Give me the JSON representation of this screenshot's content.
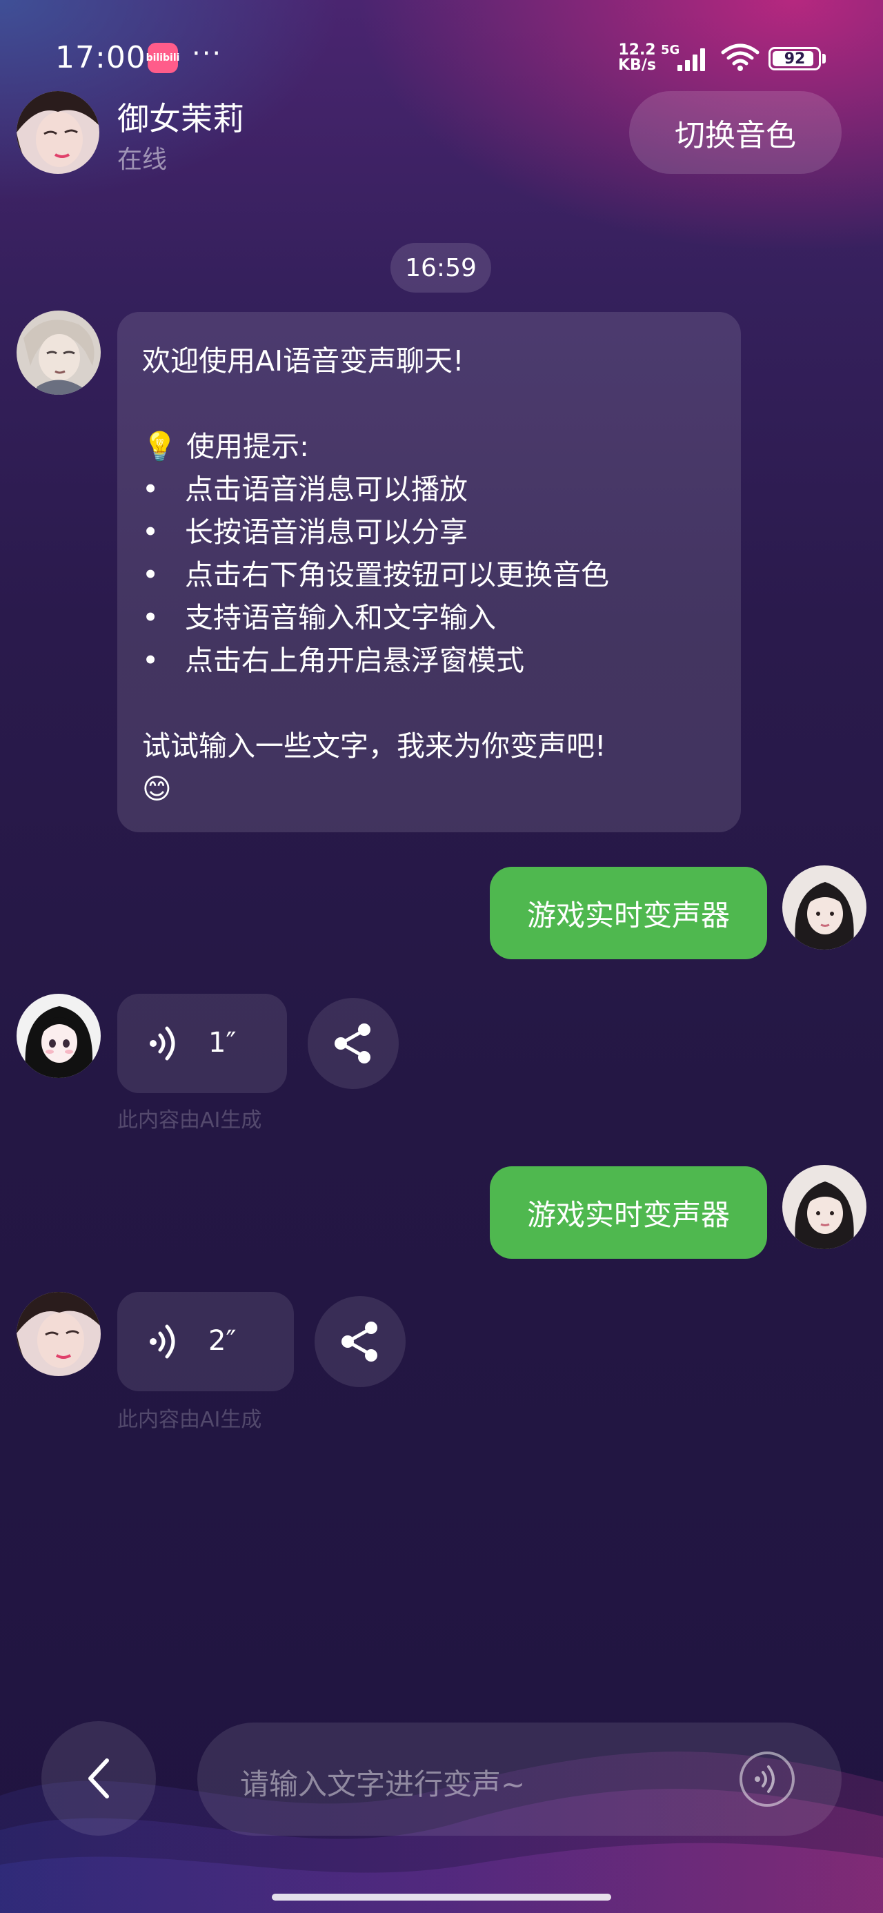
{
  "status_bar": {
    "time": "17:00",
    "app_icon_text": "bilibili",
    "more": "···",
    "net_speed_value": "12.2",
    "net_speed_unit": "KB/s",
    "network_type": "5G",
    "battery_level": "92",
    "battery_fraction": 0.92
  },
  "header": {
    "contact_name": "御女茉莉",
    "contact_status": "在线",
    "switch_voice_label": "切换音色"
  },
  "chat": {
    "timestamp": "16:59",
    "welcome": {
      "title": "欢迎使用AI语音变声聊天!",
      "tips_heading": "💡 使用提示:",
      "bullets": [
        "点击语音消息可以播放",
        "长按语音消息可以分享",
        "点击右下角设置按钮可以更换音色",
        "支持语音输入和文字输入",
        "点击右上角开启悬浮窗模式"
      ],
      "closing": "试试输入一些文字，我来为你变声吧!",
      "emoji": "😊"
    },
    "user_message_1": "游戏实时变声器",
    "voice_message_1": {
      "duration": "1″"
    },
    "ai_note_1": "此内容由AI生成",
    "user_message_2": "游戏实时变声器",
    "voice_message_2": {
      "duration": "2″"
    },
    "ai_note_2": "此内容由AI生成"
  },
  "input": {
    "placeholder": "请输入文字进行变声~"
  },
  "icons": {
    "back": "chevron-left-icon",
    "voice": "voice-wave-icon",
    "share": "share-icon"
  },
  "colors": {
    "user_bubble": "#4fb84f",
    "accent_pink": "#ff5c8a"
  }
}
